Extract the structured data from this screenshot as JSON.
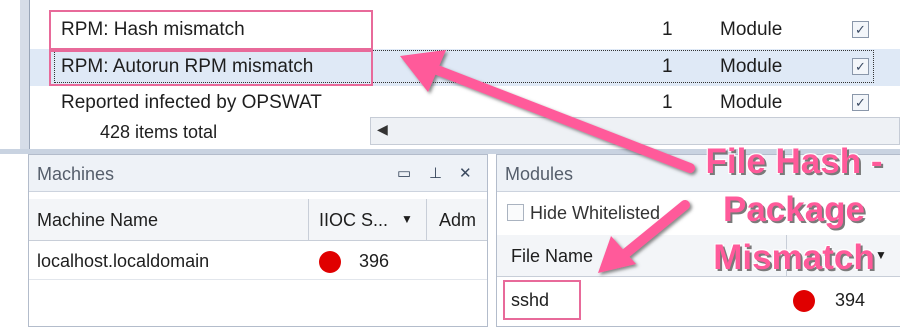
{
  "ioc_list": {
    "rows": [
      {
        "name": "RPM: Hash mismatch",
        "count": "1",
        "type": "Module",
        "checked": true
      },
      {
        "name": "RPM: Autorun RPM mismatch",
        "count": "1",
        "type": "Module",
        "checked": true
      },
      {
        "name": "Reported infected by OPSWAT",
        "count": "1",
        "type": "Module",
        "checked": true
      }
    ],
    "items_total": "428 items total"
  },
  "machines_panel": {
    "title": "Machines",
    "columns": [
      "Machine Name",
      "IIOC S...",
      "Adm"
    ],
    "rows": [
      {
        "name": "localhost.localdomain",
        "score": "396",
        "status_color": "#e00000"
      }
    ]
  },
  "modules_panel": {
    "title": "Modules",
    "hide_whitelisted_label": "Hide Whitelisted",
    "columns": [
      "File Name"
    ],
    "rows": [
      {
        "file_name": "sshd",
        "score": "394",
        "status_color": "#e00000"
      }
    ]
  },
  "annotation": {
    "lines": [
      "File Hash -",
      "Package",
      "Mismatch"
    ],
    "color": "#ff5a9a"
  },
  "highlight_color": "#e86a9a",
  "selection_color": "#dfe9f6"
}
